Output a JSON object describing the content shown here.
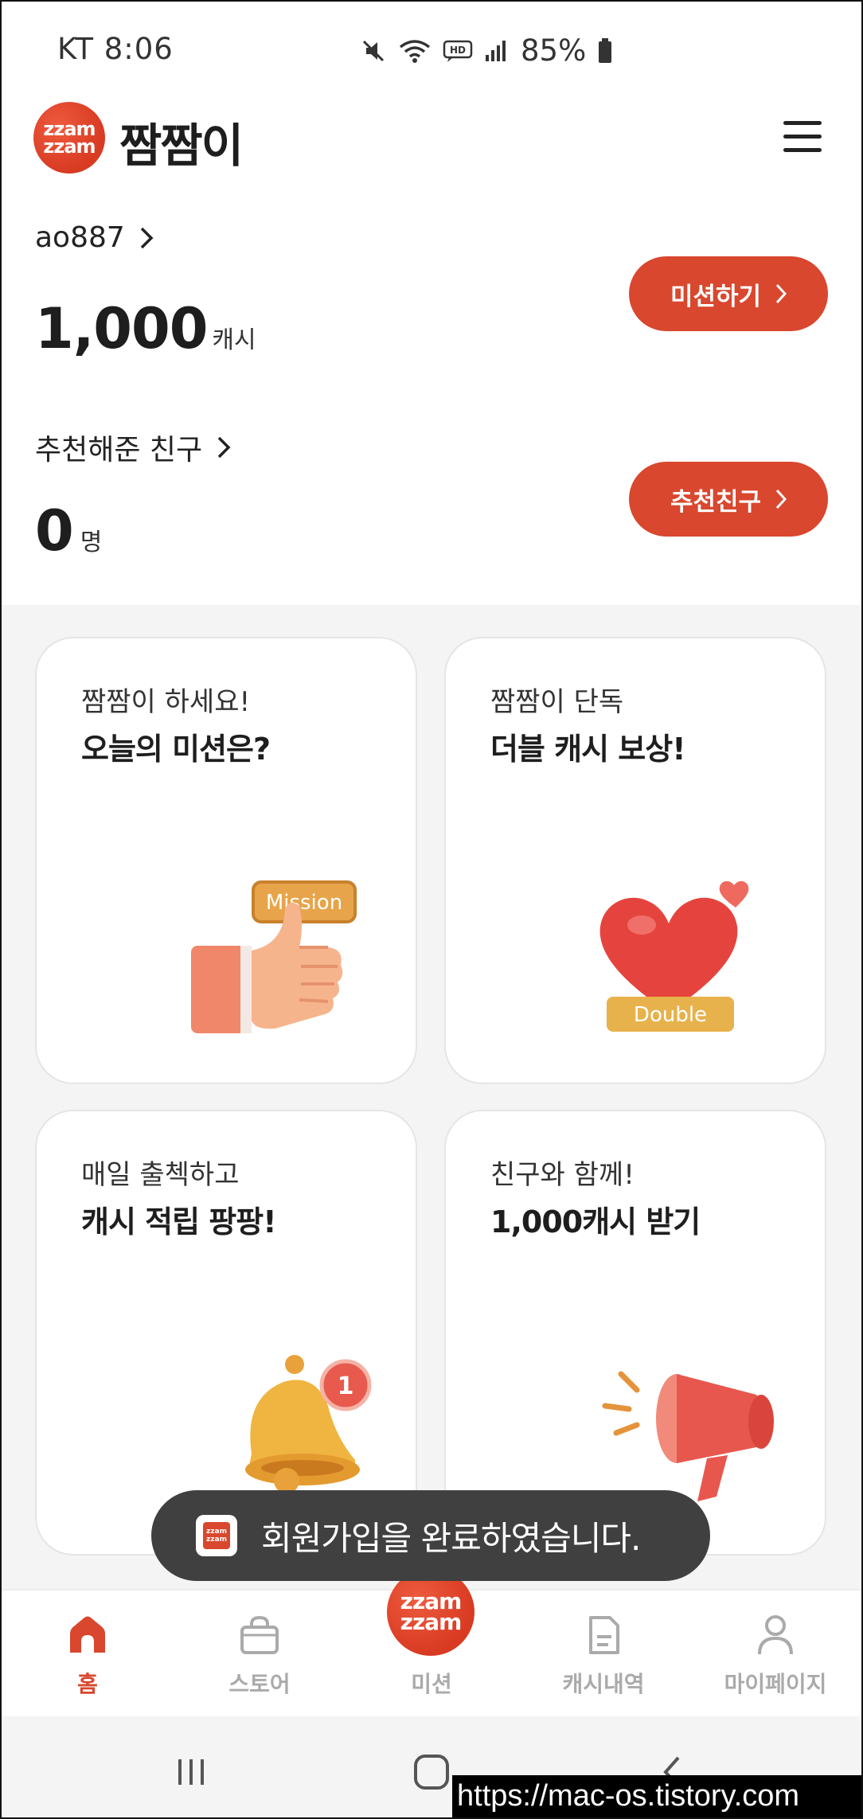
{
  "status_bar": {
    "time": "KT 8:06",
    "battery": "85%"
  },
  "header": {
    "logo_line1": "zzam",
    "logo_line2": "zzam",
    "title": "짬짬이"
  },
  "summary": {
    "username": "ao887",
    "cash_value": "1,000",
    "cash_unit": "캐시",
    "mission_button": "미션하기",
    "friends_label": "추천해준 친구",
    "friends_value": "0",
    "friends_unit": "명",
    "referral_button": "추천친구"
  },
  "cards": [
    {
      "subtitle": "짬짬이 하세요!",
      "title": "오늘의 미션은?",
      "tag": "Mission"
    },
    {
      "subtitle": "짬짬이 단독",
      "title": "더블 캐시 보상!",
      "tag": "Double"
    },
    {
      "subtitle": "매일 출첵하고",
      "title": "캐시 적립 팡팡!",
      "badge": "1"
    },
    {
      "subtitle": "친구와 함께!",
      "title": "1,000캐시 받기"
    }
  ],
  "toast": {
    "message": "회원가입을 완료하였습니다."
  },
  "bottom_nav": {
    "items": [
      {
        "label": "홈",
        "icon": "home-icon",
        "active": true
      },
      {
        "label": "스토어",
        "icon": "shopping-bag-icon"
      },
      {
        "label": "미션",
        "icon": "zzamzzam-logo-icon"
      },
      {
        "label": "캐시내역",
        "icon": "document-icon"
      },
      {
        "label": "마이페이지",
        "icon": "person-icon"
      }
    ]
  },
  "watermark": "https://mac-os.tistory.com",
  "colors": {
    "accent": "#d8472e",
    "background_grey": "#f4f4f4",
    "toast_bg": "#404040"
  }
}
